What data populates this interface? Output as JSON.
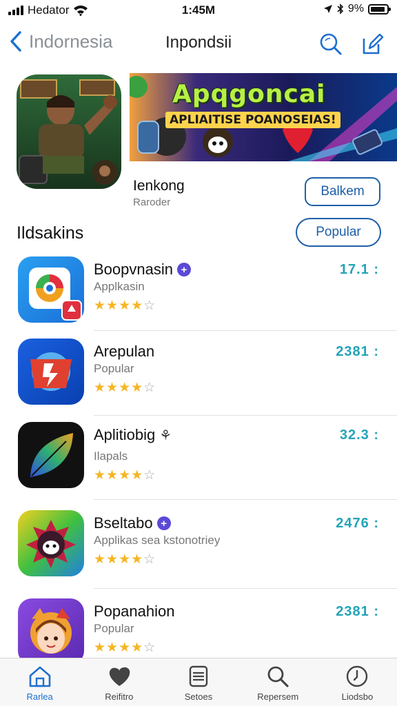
{
  "status_bar": {
    "carrier": "Hedator",
    "time": "1:45M",
    "battery": "9%"
  },
  "nav": {
    "back_label": "Indornesia",
    "title": "Inpondsii"
  },
  "featured": {
    "banner_title": "Apqgoncai",
    "banner_subtitle": "APLIAITISE POANOSEIAS!",
    "name": "Ienkong",
    "subtitle": "Raroder",
    "action_label": "Balkem"
  },
  "section": {
    "title": "Ildsakins",
    "filter_label": "Popular"
  },
  "apps": [
    {
      "name": "Boopvnasin",
      "category": "Applkasin",
      "price": "17.1 :",
      "rating": 4,
      "badge": "plus"
    },
    {
      "name": "Arepulan",
      "category": "Popular",
      "price": "2381 :",
      "rating": 4,
      "badge": ""
    },
    {
      "name": "Aplitiobig",
      "category": "Ilapals",
      "price": "32.3 :",
      "rating": 4,
      "badge": "leaf"
    },
    {
      "name": "Bseltabo",
      "category": "Applikas sea kstonotriey",
      "price": "2476 :",
      "rating": 4,
      "badge": "plus"
    },
    {
      "name": "Popanahion",
      "category": "Popular",
      "price": "2381 :",
      "rating": 4,
      "badge": ""
    }
  ],
  "tabs": [
    {
      "label": "Rarlea",
      "icon": "home-icon",
      "active": true
    },
    {
      "label": "Reifitro",
      "icon": "heart-icon",
      "active": false
    },
    {
      "label": "Setoes",
      "icon": "stack-icon",
      "active": false
    },
    {
      "label": "Repersem",
      "icon": "search-icon",
      "active": false
    },
    {
      "label": "Liodsbo",
      "icon": "clock-icon",
      "active": false
    }
  ],
  "colors": {
    "accent": "#1e5fa8",
    "price": "#23a3b8",
    "star": "#f5b623",
    "tab_active": "#1e6fd0"
  }
}
